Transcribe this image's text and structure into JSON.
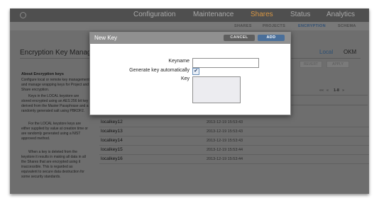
{
  "topnav": {
    "items": [
      "Configuration",
      "Maintenance",
      "Shares",
      "Status",
      "Analytics"
    ],
    "active": "Shares"
  },
  "subnav": {
    "items": [
      "SHARES",
      "PROJECTS",
      "ENCRYPTION",
      "SCHEMA"
    ],
    "active": "ENCRYPTION"
  },
  "page": {
    "title": "Encryption Key Manage",
    "tabs": [
      "Local",
      "OKM"
    ],
    "active_tab": "Local",
    "revert_label": "REVERT",
    "apply_label": "APPLY"
  },
  "sidebar": {
    "title": "About Encryption keys",
    "paragraphs": [
      "Configure local or remote key management and manage wrapping keys for Project and Share encryption.",
      "Keys in the LOCAL keystore are stored encrypted using an AES 256 bit key derived from the Master Passphrase and a randomly generated salt using PBKDF2.",
      "For the LOCAL keystore keys are either supplied by value at creation time or are randomly generated using a NIST approved method.",
      "When a key is deleted from the keystore it results in making all data in all the Shares that are encrypted using it inaccessible. This is regarded as equivalent to secure data destruction for some security standards."
    ]
  },
  "pager": {
    "first": "««",
    "prev": "«",
    "range": "1-8",
    "next": "»"
  },
  "table": {
    "rows": [
      {
        "name": "localkey12",
        "date": "2013-12-19 15:53:43"
      },
      {
        "name": "localkey13",
        "date": "2013-12-19 15:53:43"
      },
      {
        "name": "localkey14",
        "date": "2013-12-19 15:53:43"
      },
      {
        "name": "localkey15",
        "date": "2013-12-19 15:53:44"
      },
      {
        "name": "localkey16",
        "date": "2013-12-19 15:53:44"
      }
    ]
  },
  "dialog": {
    "title": "New Key",
    "cancel_label": "CANCEL",
    "add_label": "ADD",
    "keyname_label": "Keyname",
    "keyname_value": "",
    "generate_label": "Generate key automatically",
    "generate_checked": true,
    "check_glyph": "✔",
    "key_label": "Key",
    "key_value": ""
  },
  "colors": {
    "accent_active_nav": "#d79644",
    "link_blue": "#2b4e73",
    "add_button": "#4a6f9a",
    "overlay_bg": "#6e6e6e"
  }
}
